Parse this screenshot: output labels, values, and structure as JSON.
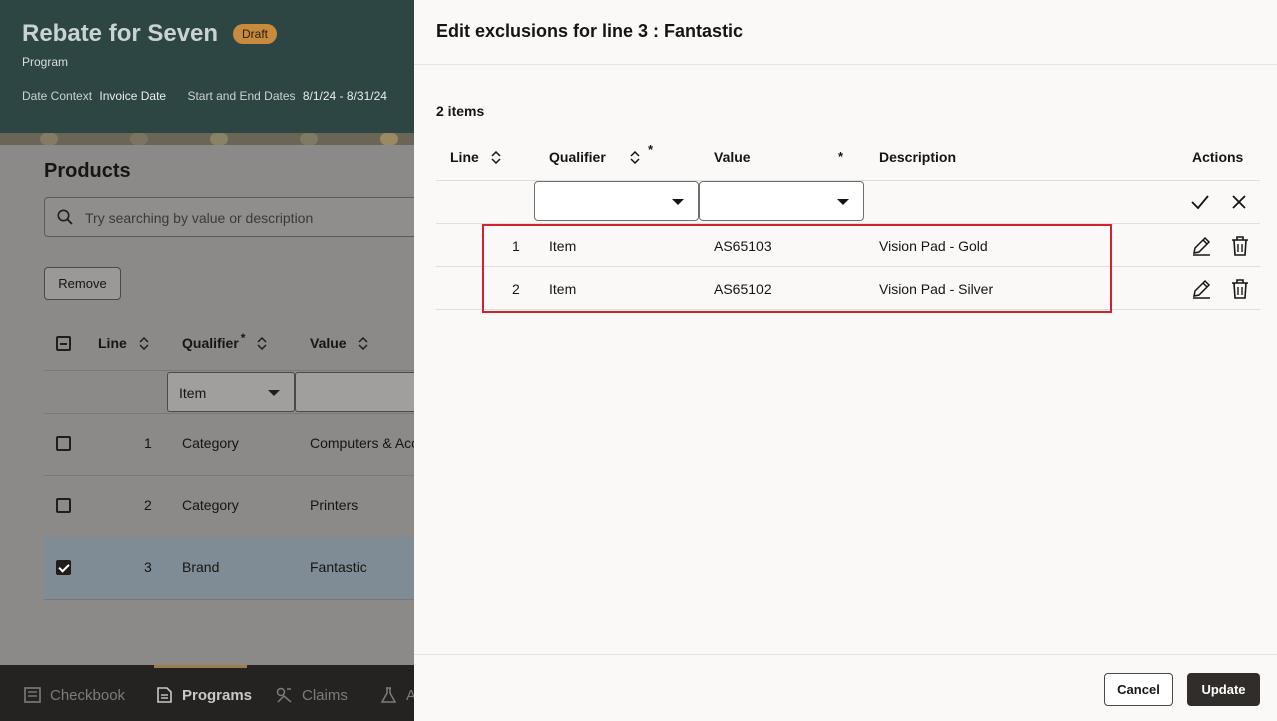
{
  "colors": {
    "header_bg": "#2e4643",
    "draft_badge": "#c88a3f",
    "highlight_border": "#d3222e",
    "update_button": "#312d2a"
  },
  "page": {
    "title": "Rebate for Seven",
    "badge": "Draft",
    "subtitle": "Program",
    "meta": [
      {
        "label": "Date Context",
        "value": "Invoice Date"
      },
      {
        "label": "Start and End Dates",
        "value": "8/1/24 - 8/31/24"
      }
    ]
  },
  "products": {
    "heading": "Products",
    "search_placeholder": "Try searching by value or description",
    "remove_label": "Remove",
    "columns": {
      "line": "Line",
      "qualifier": "Qualifier",
      "value": "Value",
      "required_mark": "*"
    },
    "filter_qualifier": "Item",
    "rows": [
      {
        "line": "1",
        "qualifier": "Category",
        "value": "Computers & Accessories",
        "checked": false
      },
      {
        "line": "2",
        "qualifier": "Category",
        "value": "Printers",
        "checked": false
      },
      {
        "line": "3",
        "qualifier": "Brand",
        "value": "Fantastic",
        "checked": true
      }
    ]
  },
  "bottom_nav": {
    "items": [
      {
        "label": "Checkbook",
        "icon": "checkbook-icon",
        "active": false
      },
      {
        "label": "Programs",
        "icon": "programs-icon",
        "active": true
      },
      {
        "label": "Claims",
        "icon": "claims-icon",
        "active": false
      },
      {
        "label": "A",
        "icon": "accruals-icon",
        "active": false
      }
    ]
  },
  "drawer": {
    "title": "Edit exclusions for line 3 : Fantastic",
    "count": "2 items",
    "columns": {
      "line": "Line",
      "qualifier": "Qualifier",
      "value": "Value",
      "description": "Description",
      "actions": "Actions",
      "required_mark": "*"
    },
    "rows": [
      {
        "line": "1",
        "qualifier": "Item",
        "value": "AS65103",
        "description": "Vision Pad - Gold"
      },
      {
        "line": "2",
        "qualifier": "Item",
        "value": "AS65102",
        "description": "Vision Pad - Silver"
      }
    ],
    "cancel_label": "Cancel",
    "update_label": "Update"
  }
}
